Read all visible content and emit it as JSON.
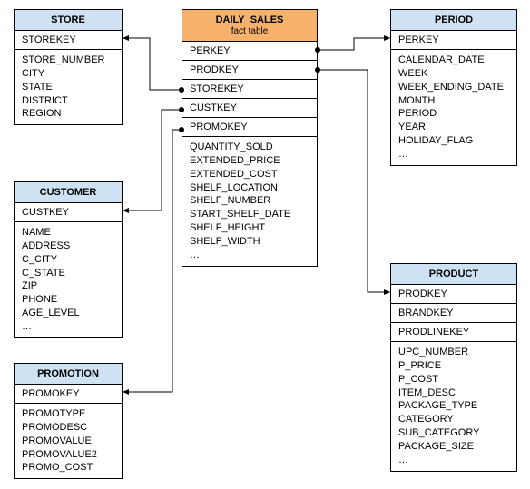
{
  "tables": {
    "store": {
      "title": "STORE",
      "key": "STOREKEY",
      "fields": [
        "STORE_NUMBER",
        "CITY",
        "STATE",
        "DISTRICT",
        "REGION"
      ]
    },
    "customer": {
      "title": "CUSTOMER",
      "key": "CUSTKEY",
      "fields": [
        "NAME",
        "ADDRESS",
        "C_CITY",
        "C_STATE",
        "ZIP",
        "PHONE",
        "AGE_LEVEL",
        "…"
      ]
    },
    "promotion": {
      "title": "PROMOTION",
      "key": "PROMOKEY",
      "fields": [
        "PROMOTYPE",
        "PROMODESC",
        "PROMOVALUE",
        "PROMOVALUE2",
        "PROMO_COST"
      ]
    },
    "daily_sales": {
      "title": "DAILY_SALES",
      "subtitle": "fact table",
      "fks": [
        "PERKEY",
        "PRODKEY",
        "STOREKEY",
        "CUSTKEY",
        "PROMOKEY"
      ],
      "fields": [
        "QUANTITY_SOLD",
        "EXTENDED_PRICE",
        "EXTENDED_COST",
        "SHELF_LOCATION",
        "SHELF_NUMBER",
        "START_SHELF_DATE",
        "SHELF_HEIGHT",
        "SHELF_WIDTH",
        "…"
      ]
    },
    "period": {
      "title": "PERIOD",
      "key": "PERKEY",
      "fields": [
        "CALENDAR_DATE",
        "WEEK",
        "WEEK_ENDING_DATE",
        "MONTH",
        "PERIOD",
        "YEAR",
        "HOLIDAY_FLAG",
        "…"
      ]
    },
    "product": {
      "title": "PRODUCT",
      "key": "PRODKEY",
      "extra_keys": [
        "BRANDKEY",
        "PRODLINEKEY"
      ],
      "fields": [
        "UPC_NUMBER",
        "P_PRICE",
        "P_COST",
        "ITEM_DESC",
        "PACKAGE_TYPE",
        "CATEGORY",
        "SUB_CATEGORY",
        "PACKAGE_SIZE",
        "…"
      ]
    }
  },
  "relationships": [
    {
      "from": "daily_sales.PERKEY",
      "to": "period.PERKEY"
    },
    {
      "from": "daily_sales.PRODKEY",
      "to": "product.PRODKEY"
    },
    {
      "from": "daily_sales.STOREKEY",
      "to": "store.STOREKEY"
    },
    {
      "from": "daily_sales.CUSTKEY",
      "to": "customer.CUSTKEY"
    },
    {
      "from": "daily_sales.PROMOKEY",
      "to": "promotion.PROMOKEY"
    }
  ]
}
